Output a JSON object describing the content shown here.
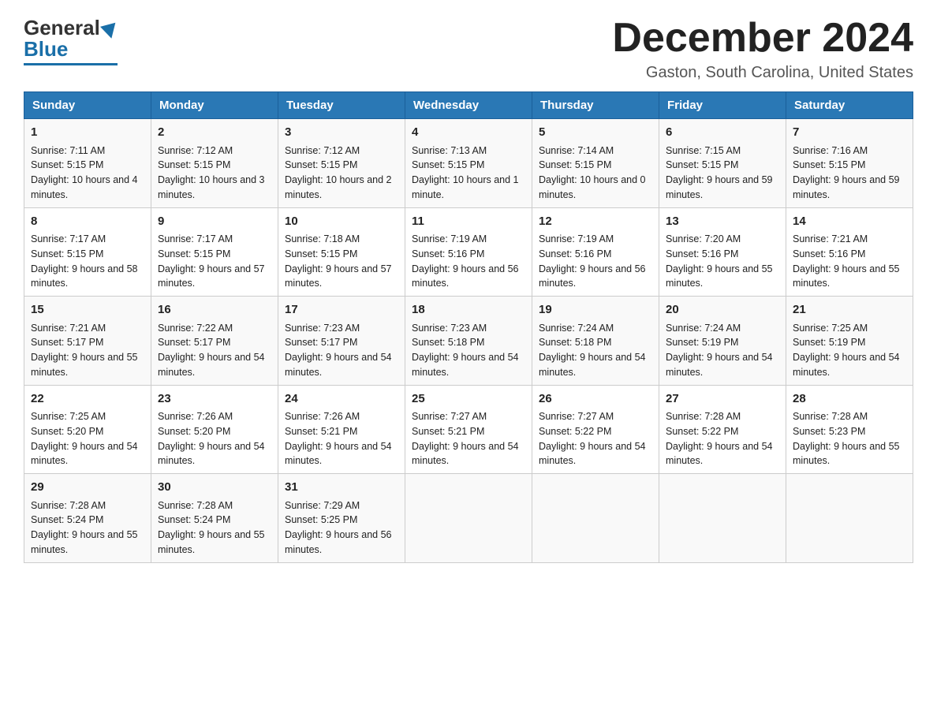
{
  "header": {
    "logo_general": "General",
    "logo_blue": "Blue",
    "month_title": "December 2024",
    "location": "Gaston, South Carolina, United States"
  },
  "days_of_week": [
    "Sunday",
    "Monday",
    "Tuesday",
    "Wednesday",
    "Thursday",
    "Friday",
    "Saturday"
  ],
  "weeks": [
    [
      {
        "day": "1",
        "sunrise": "7:11 AM",
        "sunset": "5:15 PM",
        "daylight": "10 hours and 4 minutes."
      },
      {
        "day": "2",
        "sunrise": "7:12 AM",
        "sunset": "5:15 PM",
        "daylight": "10 hours and 3 minutes."
      },
      {
        "day": "3",
        "sunrise": "7:12 AM",
        "sunset": "5:15 PM",
        "daylight": "10 hours and 2 minutes."
      },
      {
        "day": "4",
        "sunrise": "7:13 AM",
        "sunset": "5:15 PM",
        "daylight": "10 hours and 1 minute."
      },
      {
        "day": "5",
        "sunrise": "7:14 AM",
        "sunset": "5:15 PM",
        "daylight": "10 hours and 0 minutes."
      },
      {
        "day": "6",
        "sunrise": "7:15 AM",
        "sunset": "5:15 PM",
        "daylight": "9 hours and 59 minutes."
      },
      {
        "day": "7",
        "sunrise": "7:16 AM",
        "sunset": "5:15 PM",
        "daylight": "9 hours and 59 minutes."
      }
    ],
    [
      {
        "day": "8",
        "sunrise": "7:17 AM",
        "sunset": "5:15 PM",
        "daylight": "9 hours and 58 minutes."
      },
      {
        "day": "9",
        "sunrise": "7:17 AM",
        "sunset": "5:15 PM",
        "daylight": "9 hours and 57 minutes."
      },
      {
        "day": "10",
        "sunrise": "7:18 AM",
        "sunset": "5:15 PM",
        "daylight": "9 hours and 57 minutes."
      },
      {
        "day": "11",
        "sunrise": "7:19 AM",
        "sunset": "5:16 PM",
        "daylight": "9 hours and 56 minutes."
      },
      {
        "day": "12",
        "sunrise": "7:19 AM",
        "sunset": "5:16 PM",
        "daylight": "9 hours and 56 minutes."
      },
      {
        "day": "13",
        "sunrise": "7:20 AM",
        "sunset": "5:16 PM",
        "daylight": "9 hours and 55 minutes."
      },
      {
        "day": "14",
        "sunrise": "7:21 AM",
        "sunset": "5:16 PM",
        "daylight": "9 hours and 55 minutes."
      }
    ],
    [
      {
        "day": "15",
        "sunrise": "7:21 AM",
        "sunset": "5:17 PM",
        "daylight": "9 hours and 55 minutes."
      },
      {
        "day": "16",
        "sunrise": "7:22 AM",
        "sunset": "5:17 PM",
        "daylight": "9 hours and 54 minutes."
      },
      {
        "day": "17",
        "sunrise": "7:23 AM",
        "sunset": "5:17 PM",
        "daylight": "9 hours and 54 minutes."
      },
      {
        "day": "18",
        "sunrise": "7:23 AM",
        "sunset": "5:18 PM",
        "daylight": "9 hours and 54 minutes."
      },
      {
        "day": "19",
        "sunrise": "7:24 AM",
        "sunset": "5:18 PM",
        "daylight": "9 hours and 54 minutes."
      },
      {
        "day": "20",
        "sunrise": "7:24 AM",
        "sunset": "5:19 PM",
        "daylight": "9 hours and 54 minutes."
      },
      {
        "day": "21",
        "sunrise": "7:25 AM",
        "sunset": "5:19 PM",
        "daylight": "9 hours and 54 minutes."
      }
    ],
    [
      {
        "day": "22",
        "sunrise": "7:25 AM",
        "sunset": "5:20 PM",
        "daylight": "9 hours and 54 minutes."
      },
      {
        "day": "23",
        "sunrise": "7:26 AM",
        "sunset": "5:20 PM",
        "daylight": "9 hours and 54 minutes."
      },
      {
        "day": "24",
        "sunrise": "7:26 AM",
        "sunset": "5:21 PM",
        "daylight": "9 hours and 54 minutes."
      },
      {
        "day": "25",
        "sunrise": "7:27 AM",
        "sunset": "5:21 PM",
        "daylight": "9 hours and 54 minutes."
      },
      {
        "day": "26",
        "sunrise": "7:27 AM",
        "sunset": "5:22 PM",
        "daylight": "9 hours and 54 minutes."
      },
      {
        "day": "27",
        "sunrise": "7:28 AM",
        "sunset": "5:22 PM",
        "daylight": "9 hours and 54 minutes."
      },
      {
        "day": "28",
        "sunrise": "7:28 AM",
        "sunset": "5:23 PM",
        "daylight": "9 hours and 55 minutes."
      }
    ],
    [
      {
        "day": "29",
        "sunrise": "7:28 AM",
        "sunset": "5:24 PM",
        "daylight": "9 hours and 55 minutes."
      },
      {
        "day": "30",
        "sunrise": "7:28 AM",
        "sunset": "5:24 PM",
        "daylight": "9 hours and 55 minutes."
      },
      {
        "day": "31",
        "sunrise": "7:29 AM",
        "sunset": "5:25 PM",
        "daylight": "9 hours and 56 minutes."
      },
      null,
      null,
      null,
      null
    ]
  ],
  "labels": {
    "sunrise": "Sunrise:",
    "sunset": "Sunset:",
    "daylight": "Daylight:"
  }
}
